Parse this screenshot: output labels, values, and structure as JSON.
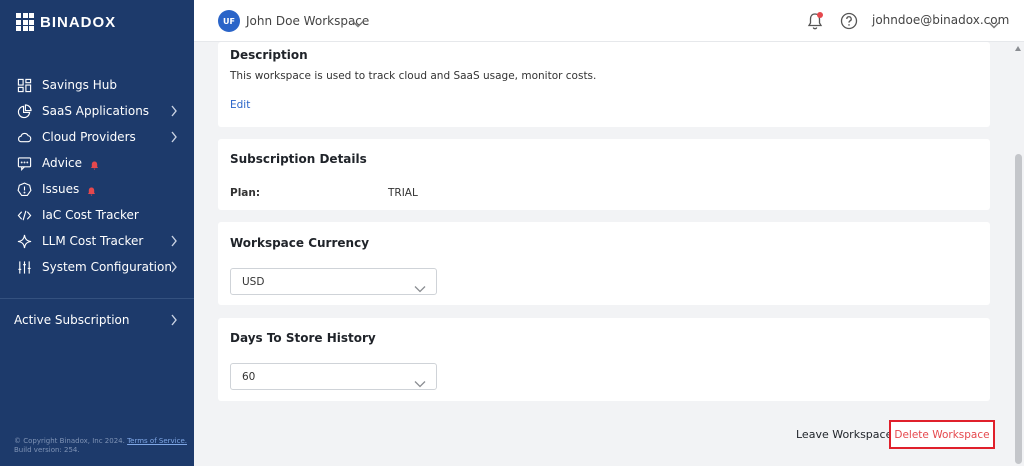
{
  "brand": {
    "name": "BINADOX"
  },
  "sidebar": {
    "items": [
      {
        "label": "Savings Hub",
        "icon": "dashboard-icon",
        "alert": false,
        "expandable": false
      },
      {
        "label": "SaaS Applications",
        "icon": "pie-chart-icon",
        "alert": false,
        "expandable": true
      },
      {
        "label": "Cloud Providers",
        "icon": "cloud-icon",
        "alert": false,
        "expandable": true
      },
      {
        "label": "Advice",
        "icon": "chat-icon",
        "alert": true,
        "expandable": false
      },
      {
        "label": "Issues",
        "icon": "warning-icon",
        "alert": true,
        "expandable": false
      },
      {
        "label": "IaC Cost Tracker",
        "icon": "code-icon",
        "alert": false,
        "expandable": false
      },
      {
        "label": "LLM Cost Tracker",
        "icon": "sparkle-icon",
        "alert": false,
        "expandable": true
      },
      {
        "label": "System Configuration",
        "icon": "sliders-icon",
        "alert": false,
        "expandable": true
      }
    ],
    "active_subscription": "Active Subscription",
    "footer": {
      "copyright": "© Copyright Binadox, Inc 2024.",
      "terms": "Terms of Service.",
      "build": "Build version: 254."
    }
  },
  "header": {
    "avatar_initials": "UF",
    "workspace_name": "John Doe Workspace",
    "user_email": "johndoe@binadox.com"
  },
  "description": {
    "title": "Description",
    "text": "This workspace is used to track cloud and SaaS usage, monitor costs.",
    "edit_label": "Edit"
  },
  "subscription": {
    "title": "Subscription Details",
    "plan_label": "Plan:",
    "plan_value": "TRIAL"
  },
  "currency": {
    "title": "Workspace Currency",
    "value": "USD"
  },
  "history": {
    "title": "Days To Store History",
    "value": "60"
  },
  "actions": {
    "leave_label": "Leave Workspace",
    "delete_label": "Delete Workspace"
  },
  "colors": {
    "sidebar_bg": "#1d3a6b",
    "accent": "#2a64c8",
    "alert": "#e5484d",
    "danger_border": "#e0202b"
  }
}
